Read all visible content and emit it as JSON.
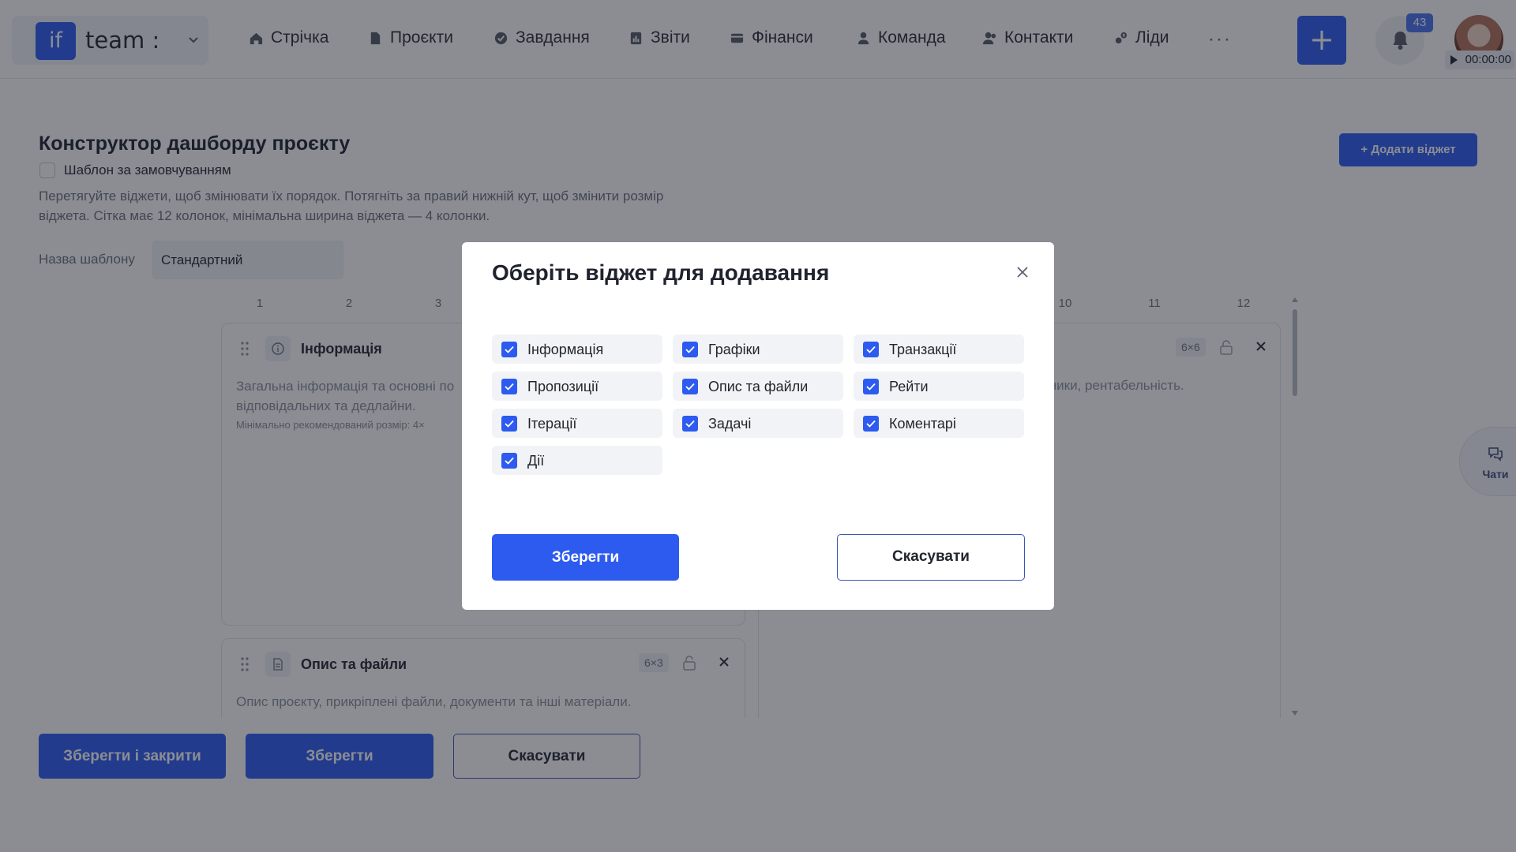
{
  "brand": {
    "logo_text": "if",
    "name": "team :"
  },
  "nav": [
    {
      "label": "Стрічка",
      "icon": "home-icon"
    },
    {
      "label": "Проєкти",
      "icon": "document-icon"
    },
    {
      "label": "Завдання",
      "icon": "check-circle-icon"
    },
    {
      "label": "Звіти",
      "icon": "chart-icon"
    },
    {
      "label": "Фінанси",
      "icon": "wallet-icon"
    },
    {
      "label": "Команда",
      "icon": "user-icon"
    },
    {
      "label": "Контакти",
      "icon": "contacts-icon"
    },
    {
      "label": "Ліди",
      "icon": "leads-icon"
    }
  ],
  "header": {
    "more": "···",
    "add": "+",
    "notifications_count": "43",
    "timer": "00:00:00"
  },
  "page": {
    "title": "Конструктор дашборду проєкту",
    "default_template_label": "Шаблон за замовчуванням",
    "hint_line1": "Перетягуйте віджети, щоб змінювати їх порядок. Потягніть за правий нижній кут, щоб змінити розмір",
    "hint_line2": "віджета. Сітка має 12 колонок, мінімальна ширина віджета — 4 колонки.",
    "template_name_label": "Назва шаблону",
    "template_name_value": "Стандартний",
    "add_widget_button": "+ Додати віджет",
    "columns": [
      "1",
      "2",
      "3",
      "10",
      "11",
      "12"
    ]
  },
  "widgets": {
    "info": {
      "title": "Інформація",
      "desc1": "Загальна інформація та основні по",
      "desc2": "відповідальних та дедлайни.",
      "min": "Мінімально рекомендований розмір: 4×"
    },
    "right": {
      "size": "6×6",
      "desc": "зники, рентабельність."
    },
    "files": {
      "title": "Опис та файли",
      "size": "6×3",
      "desc": "Опис проєкту, прикріплені файли, документи та інші матеріали."
    }
  },
  "chats": {
    "label": "Чати"
  },
  "footer": {
    "save_close": "Зберегти і закрити",
    "save": "Зберегти",
    "cancel": "Скасувати"
  },
  "modal": {
    "title": "Оберіть віджет для додавання",
    "options": [
      {
        "label": "Інформація",
        "checked": true
      },
      {
        "label": "Графіки",
        "checked": true
      },
      {
        "label": "Транзакції",
        "checked": true
      },
      {
        "label": "Пропозиції",
        "checked": true
      },
      {
        "label": "Опис та файли",
        "checked": true
      },
      {
        "label": "Рейти",
        "checked": true
      },
      {
        "label": "Ітерації",
        "checked": true
      },
      {
        "label": "Задачі",
        "checked": true
      },
      {
        "label": "Коментарі",
        "checked": true
      },
      {
        "label": "Дії",
        "checked": true
      }
    ],
    "save": "Зберегти",
    "cancel": "Скасувати"
  },
  "colors": {
    "accent": "#2d5bf0",
    "overlay": "#181c28",
    "badge": "#4b73f0"
  }
}
